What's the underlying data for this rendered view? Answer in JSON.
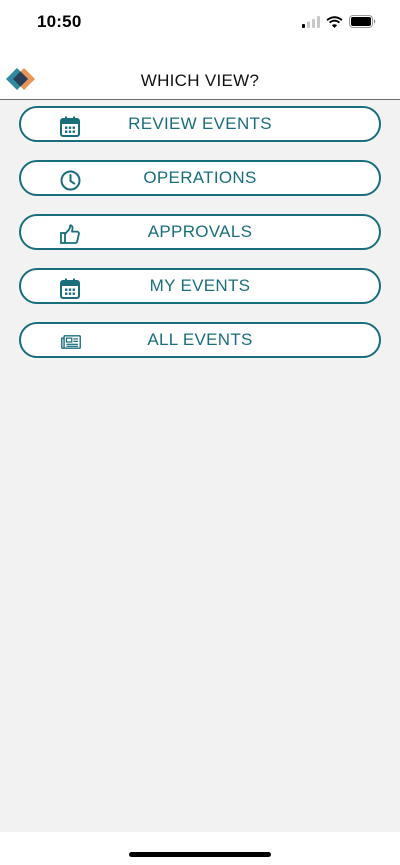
{
  "status_bar": {
    "time": "10:50",
    "signal_icon": "cellular-signal-icon",
    "wifi_icon": "wifi-icon",
    "battery_icon": "battery-icon"
  },
  "header": {
    "logo_icon": "app-logo-icon",
    "title": "WHICH VIEW?"
  },
  "menu": {
    "items": [
      {
        "label": "REVIEW EVENTS",
        "icon": "calendar-icon"
      },
      {
        "label": "OPERATIONS",
        "icon": "clock-icon"
      },
      {
        "label": "APPROVALS",
        "icon": "thumbs-up-icon"
      },
      {
        "label": "MY EVENTS",
        "icon": "calendar-icon"
      },
      {
        "label": "ALL EVENTS",
        "icon": "newspaper-icon"
      }
    ]
  },
  "colors": {
    "accent": "#1a6e7c",
    "background": "#f2f2f2",
    "logo_blue": "#2f8aa0",
    "logo_orange": "#e9955a"
  }
}
